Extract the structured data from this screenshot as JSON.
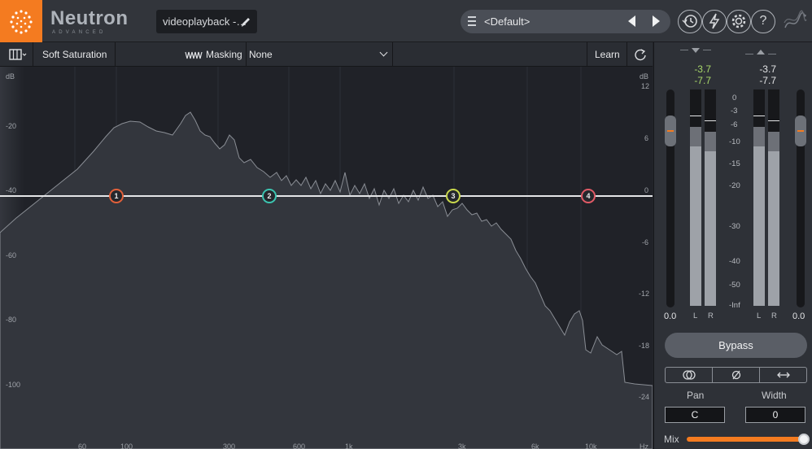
{
  "topbar": {
    "brand": "Neutron",
    "brand_sub": "ADVANCED",
    "file_name": "videoplayback -…",
    "preset_name": "<Default>",
    "buttons": [
      "history-icon",
      "lightning-icon",
      "gear-icon",
      "help-icon"
    ],
    "help_label": "?"
  },
  "modbar": {
    "module_name": "Soft Saturation",
    "masking_label": "Masking",
    "masking_value": "None",
    "learn_label": "Learn"
  },
  "display": {
    "db_left_title": "dB",
    "db_left": [
      "-20",
      "-40",
      "-60",
      "-80",
      "-100"
    ],
    "db_right_title": "dB",
    "db_right": [
      "12",
      "6",
      "0",
      "-6",
      "-12",
      "-18",
      "-24"
    ],
    "freq": [
      "60",
      "100",
      "300",
      "600",
      "1k",
      "3k",
      "6k",
      "10k",
      "Hz"
    ],
    "nodes": [
      {
        "label": "1",
        "color": "#e2603a"
      },
      {
        "label": "2",
        "color": "#3cc4b0"
      },
      {
        "label": "3",
        "color": "#c9d84c"
      },
      {
        "label": "4",
        "color": "#e05a66"
      }
    ]
  },
  "meters": {
    "input_peak": "-3.7",
    "input_rms": "-7.7",
    "output_peak": "-3.7",
    "output_rms": "-7.7",
    "scale": [
      "0",
      "-3",
      "-6",
      "-10",
      "-15",
      "-20",
      "-30",
      "-40",
      "-50",
      "-Inf"
    ],
    "input_gain": "0.0",
    "output_gain": "0.0",
    "channel_l": "L",
    "channel_r": "R",
    "bypass_label": "Bypass",
    "pan_label": "Pan",
    "width_label": "Width",
    "pan_value": "C",
    "width_value": "0",
    "mix_label": "Mix",
    "mix_level": 1.0
  },
  "colors": {
    "accent": "#f47b20",
    "peak_green": "#a8d86a"
  }
}
